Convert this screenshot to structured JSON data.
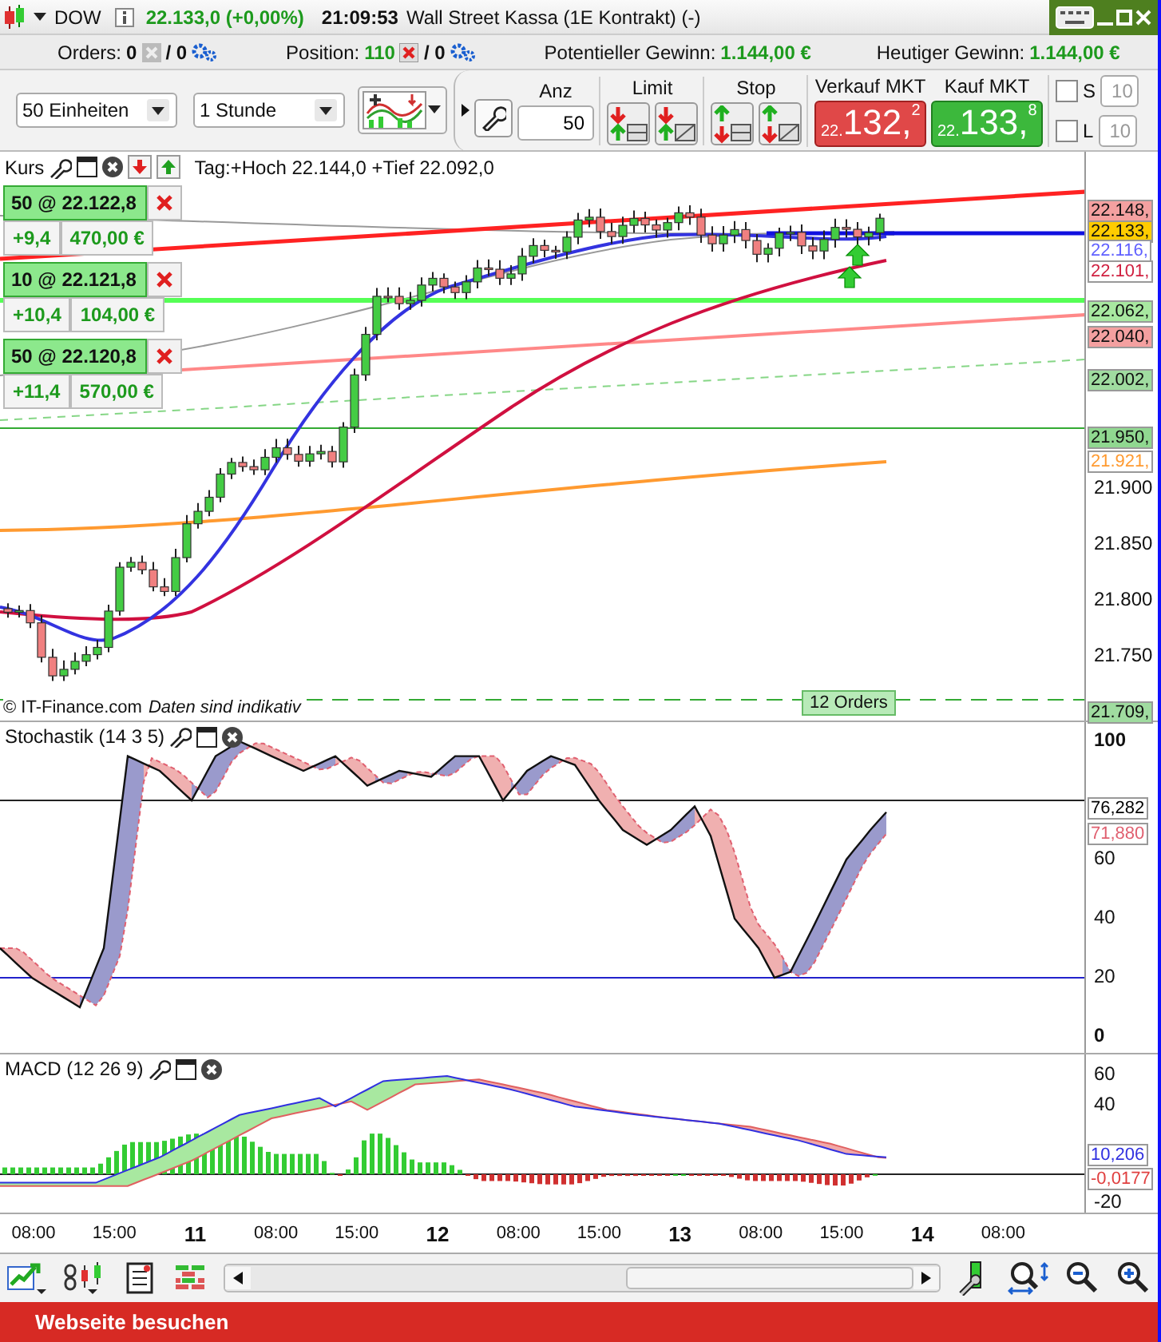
{
  "title_bar": {
    "symbol": "DOW",
    "price": "22.133,0 (+0,00%)",
    "time": "21:09:53",
    "instrument": "Wall Street Kassa (1E Kontrakt) (-)"
  },
  "account_bar": {
    "orders_label": "Orders:",
    "orders_count": "0",
    "orders_sep": "/ 0",
    "position_label": "Position:",
    "position_count": "110",
    "position_sep": "/ 0",
    "potential_label": "Potentieller Gewinn:",
    "potential_value": "1.144,00 €",
    "today_label": "Heutiger Gewinn:",
    "today_value": "1.144,00 €"
  },
  "toolbar": {
    "units": "50 Einheiten",
    "interval": "1 Stunde",
    "anz_label": "Anz",
    "anz_value": "50",
    "limit_label": "Limit",
    "stop_label": "Stop",
    "sell_label": "Verkauf MKT",
    "sell_prefix": "22.",
    "sell_main": "132,",
    "sell_sup": "2",
    "buy_label": "Kauf MKT",
    "buy_prefix": "22.",
    "buy_main": "133,",
    "buy_sup": "8",
    "s_label": "S",
    "s_checked": false,
    "s_value": "10",
    "l_label": "L",
    "l_checked": false,
    "l_value": "10"
  },
  "main_panel": {
    "title": "Kurs",
    "info": "Tag:+Hoch 22.144,0 +Tief 22.092,0",
    "positions": [
      {
        "order": "50 @ 22.122,8",
        "points": "+9,4",
        "profit": "470,00 €"
      },
      {
        "order": "10 @ 22.121,8",
        "points": "+10,4",
        "profit": "104,00 €"
      },
      {
        "order": "50 @ 22.120,8",
        "points": "+11,4",
        "profit": "570,00 €"
      }
    ],
    "axis_labels": [
      "21.900",
      "21.850",
      "21.800",
      "21.750"
    ],
    "price_tags": [
      {
        "value": "22.148,",
        "kind": "filled",
        "color": "#f4a0a0"
      },
      {
        "value": "22.133,",
        "kind": "filled",
        "color": "#ffcc00"
      },
      {
        "value": "22.116,",
        "kind": "outline",
        "color": "#6060ff"
      },
      {
        "value": "22.101,",
        "kind": "outline",
        "color": "#d02040"
      },
      {
        "value": "22.062,",
        "kind": "filled",
        "color": "#a8e8a0"
      },
      {
        "value": "22.040,",
        "kind": "filled",
        "color": "#f4a0a0"
      },
      {
        "value": "22.002,",
        "kind": "filled",
        "color": "#a0dca0"
      },
      {
        "value": "21.950,",
        "kind": "filled",
        "color": "#90d890"
      },
      {
        "value": "21.921,",
        "kind": "outline",
        "color": "#ff9a30"
      },
      {
        "value": "21.709,",
        "kind": "filled",
        "color": "#a0dca0"
      }
    ],
    "orders_tag": "12 Orders",
    "copyright": "© IT-Finance.com",
    "disclaimer": "Daten sind indikativ"
  },
  "stochastic_panel": {
    "title": "Stochastik (14 3 5)",
    "axis_labels": [
      "100",
      "60",
      "40",
      "20",
      "0"
    ],
    "value_tags": [
      {
        "value": "76,282",
        "color": "#000000"
      },
      {
        "value": "71,880",
        "color": "#e06070"
      }
    ]
  },
  "macd_panel": {
    "title": "MACD (12 26 9)",
    "axis_labels": [
      "60",
      "40",
      "-20"
    ],
    "value_tags": [
      {
        "value": "10,206",
        "color": "#3030e0"
      },
      {
        "value": "-0,0177",
        "color": "#e04040"
      }
    ]
  },
  "time_axis": [
    {
      "label": "08:00",
      "kind": "hour"
    },
    {
      "label": "15:00",
      "kind": "hour"
    },
    {
      "label": "11",
      "kind": "day"
    },
    {
      "label": "08:00",
      "kind": "hour"
    },
    {
      "label": "15:00",
      "kind": "hour"
    },
    {
      "label": "12",
      "kind": "day"
    },
    {
      "label": "08:00",
      "kind": "hour"
    },
    {
      "label": "15:00",
      "kind": "hour"
    },
    {
      "label": "13",
      "kind": "day"
    },
    {
      "label": "08:00",
      "kind": "hour"
    },
    {
      "label": "15:00",
      "kind": "hour"
    },
    {
      "label": "14",
      "kind": "day"
    },
    {
      "label": "08:00",
      "kind": "hour"
    }
  ],
  "banner": {
    "link": "Webseite besuchen"
  }
}
